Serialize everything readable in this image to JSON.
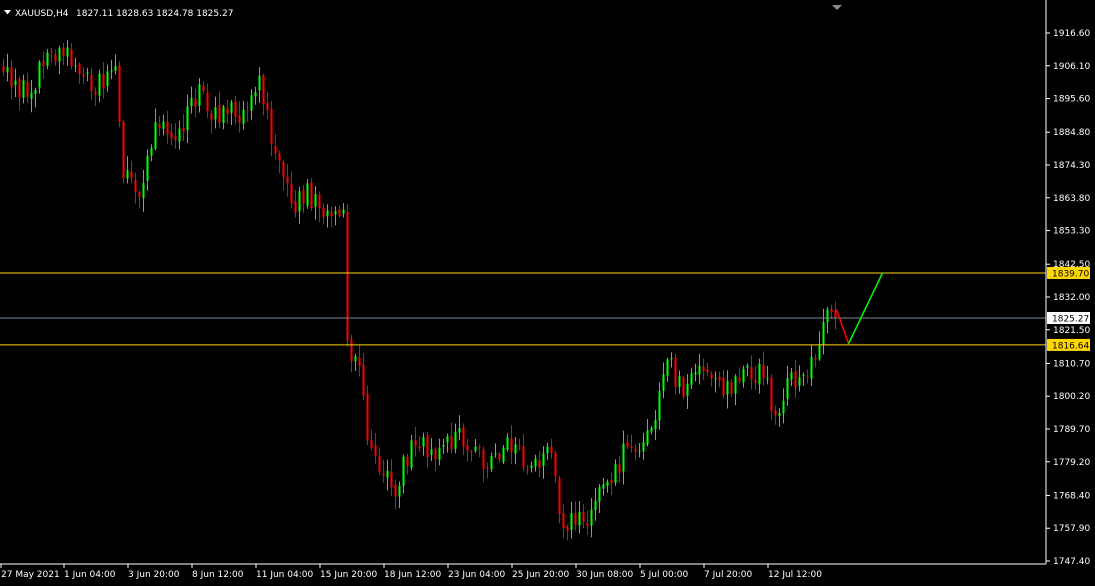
{
  "header": {
    "symbol_timeframe": "XAUUSD,H4",
    "ohlc": "1827.11 1828.63 1824.78 1825.27"
  },
  "colors": {
    "background": "#000000",
    "axis": "#ffffff",
    "bull": "#00ff00",
    "bear": "#ff0000",
    "level_line": "#ffd700",
    "price_line": "#778899",
    "projection_up": "#00ff00",
    "projection_down": "#ff0000"
  },
  "price_labels": {
    "resistance": "1839.70",
    "current": "1825.27",
    "support": "1816.64"
  },
  "chart_data": {
    "type": "candlestick",
    "y_ticks": [
      "1916.60",
      "1906.10",
      "1895.60",
      "1884.80",
      "1874.30",
      "1863.80",
      "1853.30",
      "1842.50",
      "1832.00",
      "1821.50",
      "1810.70",
      "1800.20",
      "1789.70",
      "1779.20",
      "1768.40",
      "1757.90",
      "1747.40"
    ],
    "ylim": [
      1747.4,
      1916.6
    ],
    "x_labels": [
      "27 May 2021",
      "1 Jun 04:00",
      "3 Jun 20:00",
      "8 Jun 12:00",
      "11 Jun 04:00",
      "15 Jun 20:00",
      "18 Jun 12:00",
      "23 Jun 04:00",
      "25 Jun 20:00",
      "30 Jun 08:00",
      "5 Jul 00:00",
      "7 Jul 20:00",
      "12 Jul 12:00"
    ],
    "horizontal_levels": [
      {
        "price": 1839.7,
        "kind": "resistance"
      },
      {
        "price": 1816.64,
        "kind": "support"
      },
      {
        "price": 1825.27,
        "kind": "current"
      }
    ],
    "projection": [
      {
        "from_price": 1828.0,
        "to_price": 1817.0,
        "direction": "down"
      },
      {
        "from_price": 1817.0,
        "to_price": 1839.7,
        "direction": "up"
      }
    ],
    "anchors": [
      {
        "i": 0,
        "close": 1904
      },
      {
        "i": 4,
        "close": 1896
      },
      {
        "i": 10,
        "close": 1906
      },
      {
        "i": 16,
        "close": 1912
      },
      {
        "i": 22,
        "close": 1898
      },
      {
        "i": 28,
        "close": 1906
      },
      {
        "i": 30,
        "close": 1870
      },
      {
        "i": 34,
        "close": 1864
      },
      {
        "i": 38,
        "close": 1888
      },
      {
        "i": 44,
        "close": 1886
      },
      {
        "i": 50,
        "close": 1898
      },
      {
        "i": 54,
        "close": 1888
      },
      {
        "i": 60,
        "close": 1892
      },
      {
        "i": 64,
        "close": 1903
      },
      {
        "i": 68,
        "close": 1878
      },
      {
        "i": 72,
        "close": 1862
      },
      {
        "i": 78,
        "close": 1865
      },
      {
        "i": 82,
        "close": 1858
      },
      {
        "i": 85,
        "close": 1860
      },
      {
        "i": 86,
        "close": 1818
      },
      {
        "i": 89,
        "close": 1810
      },
      {
        "i": 91,
        "close": 1786
      },
      {
        "i": 94,
        "close": 1776
      },
      {
        "i": 98,
        "close": 1768
      },
      {
        "i": 102,
        "close": 1786
      },
      {
        "i": 108,
        "close": 1780
      },
      {
        "i": 114,
        "close": 1790
      },
      {
        "i": 120,
        "close": 1777
      },
      {
        "i": 126,
        "close": 1787
      },
      {
        "i": 132,
        "close": 1778
      },
      {
        "i": 137,
        "close": 1782
      },
      {
        "i": 140,
        "close": 1758
      },
      {
        "i": 145,
        "close": 1760
      },
      {
        "i": 150,
        "close": 1772
      },
      {
        "i": 156,
        "close": 1784
      },
      {
        "i": 162,
        "close": 1790
      },
      {
        "i": 166,
        "close": 1812
      },
      {
        "i": 170,
        "close": 1800
      },
      {
        "i": 174,
        "close": 1810
      },
      {
        "i": 178,
        "close": 1806
      },
      {
        "i": 182,
        "close": 1801
      },
      {
        "i": 186,
        "close": 1810
      },
      {
        "i": 190,
        "close": 1806
      },
      {
        "i": 193,
        "close": 1794
      },
      {
        "i": 196,
        "close": 1806
      },
      {
        "i": 200,
        "close": 1807
      },
      {
        "i": 203,
        "close": 1812
      },
      {
        "i": 206,
        "close": 1828
      },
      {
        "i": 208,
        "close": 1825.27
      }
    ]
  }
}
